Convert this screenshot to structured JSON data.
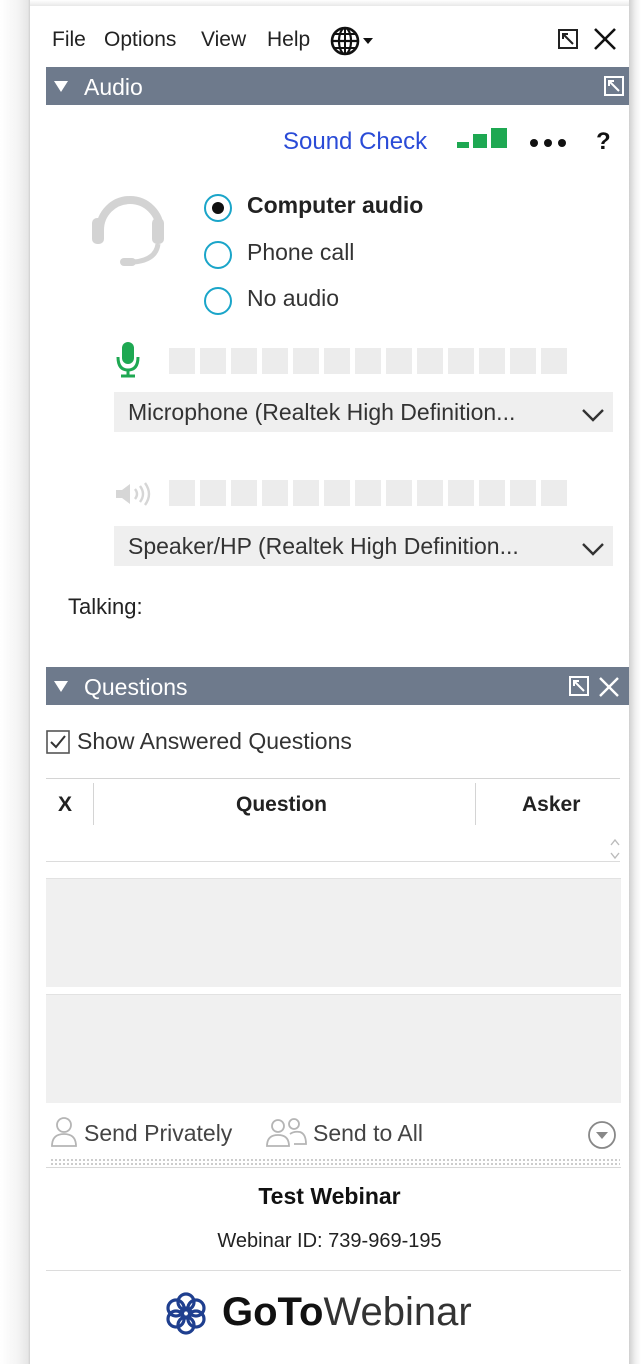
{
  "menu": {
    "file": "File",
    "options": "Options",
    "view": "View",
    "help": "Help"
  },
  "audio": {
    "title": "Audio",
    "sound_check": "Sound Check",
    "options": [
      {
        "label": "Computer audio",
        "selected": true
      },
      {
        "label": "Phone call",
        "selected": false
      },
      {
        "label": "No audio",
        "selected": false
      }
    ],
    "microphone": "Microphone (Realtek High Definition...",
    "speaker": "Speaker/HP (Realtek High Definition...",
    "talking_label": "Talking:",
    "mic_level": 0,
    "speaker_level": 0
  },
  "questions": {
    "title": "Questions",
    "show_answered": "Show Answered Questions",
    "show_answered_checked": true,
    "columns": [
      "X",
      "Question",
      "Asker"
    ],
    "send_privately": "Send Privately",
    "send_to_all": "Send to All"
  },
  "webinar": {
    "title": "Test Webinar",
    "id_line": "Webinar ID: 739-969-195",
    "brand_goto": "GoTo",
    "brand_webinar": "Webinar"
  },
  "colors": {
    "header_bar": "#6e7a8c",
    "link": "#2a4bd7",
    "radio": "#1aa5c9",
    "mic_green": "#1ea852",
    "brand_blue": "#1f3f8f"
  }
}
